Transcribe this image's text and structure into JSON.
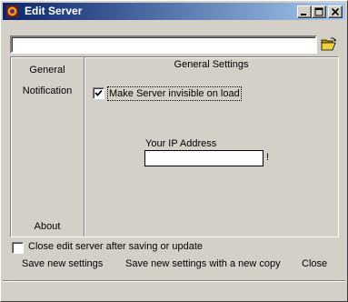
{
  "window": {
    "title": "Edit Server"
  },
  "titlebar_buttons": {
    "minimize_icon": "minimize-icon",
    "maximize_icon": "maximize-icon",
    "close_icon": "close-icon"
  },
  "file_path": {
    "value": "",
    "placeholder": "",
    "browse_icon": "open-folder-icon"
  },
  "nav": {
    "general": "General",
    "notification": "Notification",
    "about": "About"
  },
  "section": {
    "title": "General Settings",
    "invisible_option": {
      "label": "Make Server invisible on load",
      "checked": true
    },
    "ip": {
      "label": "Your IP Address",
      "value": "",
      "suffix": "!"
    }
  },
  "options": {
    "close_after_save": {
      "label": "Close edit server after saving or update",
      "checked": false
    }
  },
  "buttons": {
    "save": "Save new settings",
    "save_copy": "Save new settings with a new copy",
    "close": "Close"
  },
  "colors": {
    "titlebar_start": "#0a246a",
    "titlebar_end": "#a6caf0",
    "face": "#d4d0c8"
  }
}
